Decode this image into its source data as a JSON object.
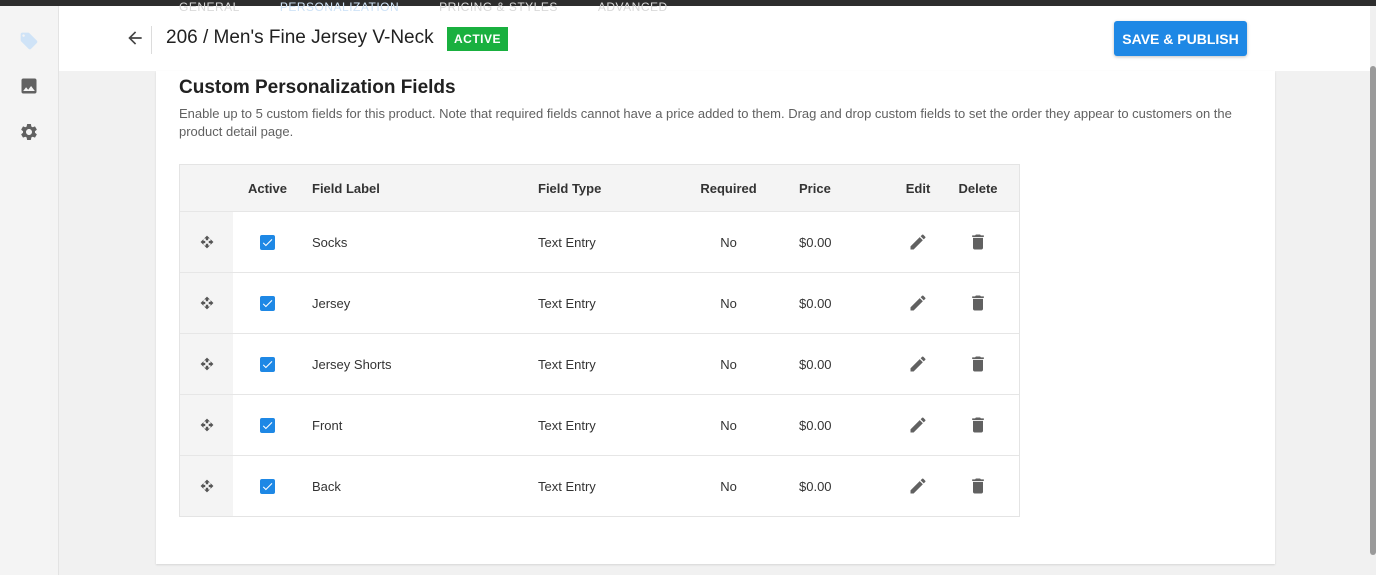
{
  "header": {
    "ghost_tabs": [
      "GENERAL",
      "PERSONALIZATION",
      "PRICING & STYLES",
      "ADVANCED"
    ],
    "title": "206 / Men's Fine Jersey V-Neck",
    "status": "ACTIVE",
    "save_label": "SAVE & PUBLISH"
  },
  "sidebar": {
    "icons": [
      "tag-icon",
      "image-icon",
      "gear-icon"
    ]
  },
  "section": {
    "title": "Custom Personalization Fields",
    "description": "Enable up to 5 custom fields for this product. Note that required fields cannot have a price added to them. Drag and drop custom fields to set the order they appear to customers on the product detail page."
  },
  "table": {
    "columns": {
      "active": "Active",
      "label": "Field Label",
      "type": "Field Type",
      "required": "Required",
      "price": "Price",
      "edit": "Edit",
      "delete": "Delete"
    },
    "rows": [
      {
        "active": true,
        "label": "Socks",
        "type": "Text Entry",
        "required": "No",
        "price": "$0.00"
      },
      {
        "active": true,
        "label": "Jersey",
        "type": "Text Entry",
        "required": "No",
        "price": "$0.00"
      },
      {
        "active": true,
        "label": "Jersey Shorts",
        "type": "Text Entry",
        "required": "No",
        "price": "$0.00"
      },
      {
        "active": true,
        "label": "Front",
        "type": "Text Entry",
        "required": "No",
        "price": "$0.00"
      },
      {
        "active": true,
        "label": "Back",
        "type": "Text Entry",
        "required": "No",
        "price": "$0.00"
      }
    ]
  },
  "colors": {
    "primary": "#1e88e5",
    "status_active": "#19b03f",
    "icon_gray": "#616161"
  }
}
